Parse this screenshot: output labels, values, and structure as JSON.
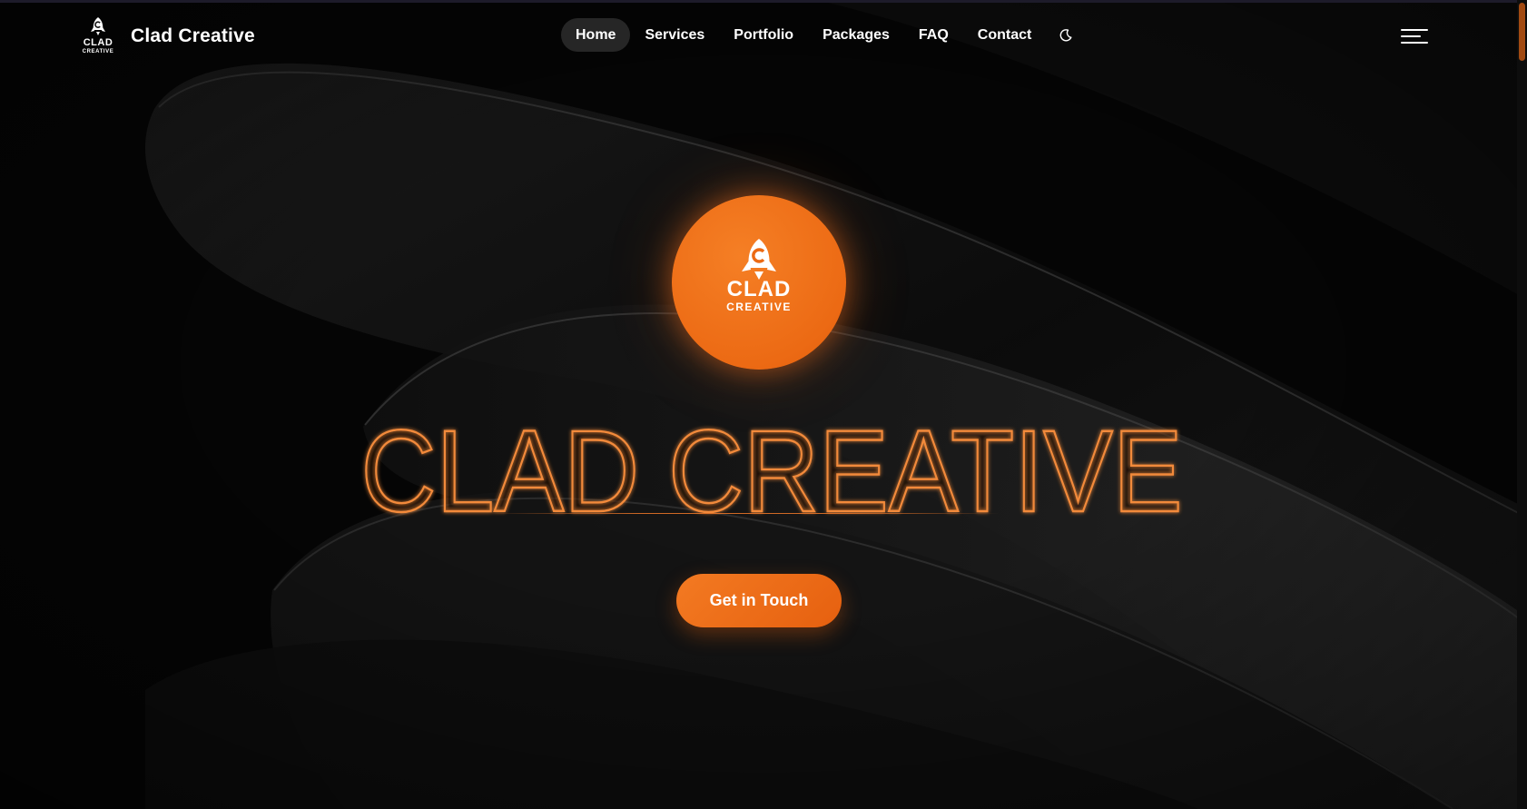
{
  "brand": {
    "name": "Clad Creative",
    "logo_word_1": "CLAD",
    "logo_word_2": "CREATIVE",
    "logo_icon": "rocket-c-icon"
  },
  "nav": {
    "items": [
      {
        "label": "Home",
        "active": true
      },
      {
        "label": "Services",
        "active": false
      },
      {
        "label": "Portfolio",
        "active": false
      },
      {
        "label": "Packages",
        "active": false
      },
      {
        "label": "FAQ",
        "active": false
      },
      {
        "label": "Contact",
        "active": false
      }
    ],
    "theme_toggle_icon": "moon-icon",
    "menu_icon": "hamburger-menu-icon"
  },
  "hero": {
    "badge_word_1": "CLAD",
    "badge_word_2": "CREATIVE",
    "headline": "CLAD CREATIVE",
    "cta_label": "Get in Touch"
  },
  "colors": {
    "accent": "#ED6A16",
    "background": "#050505",
    "nav_active_bg": "#262626",
    "text": "#FFFFFF"
  }
}
